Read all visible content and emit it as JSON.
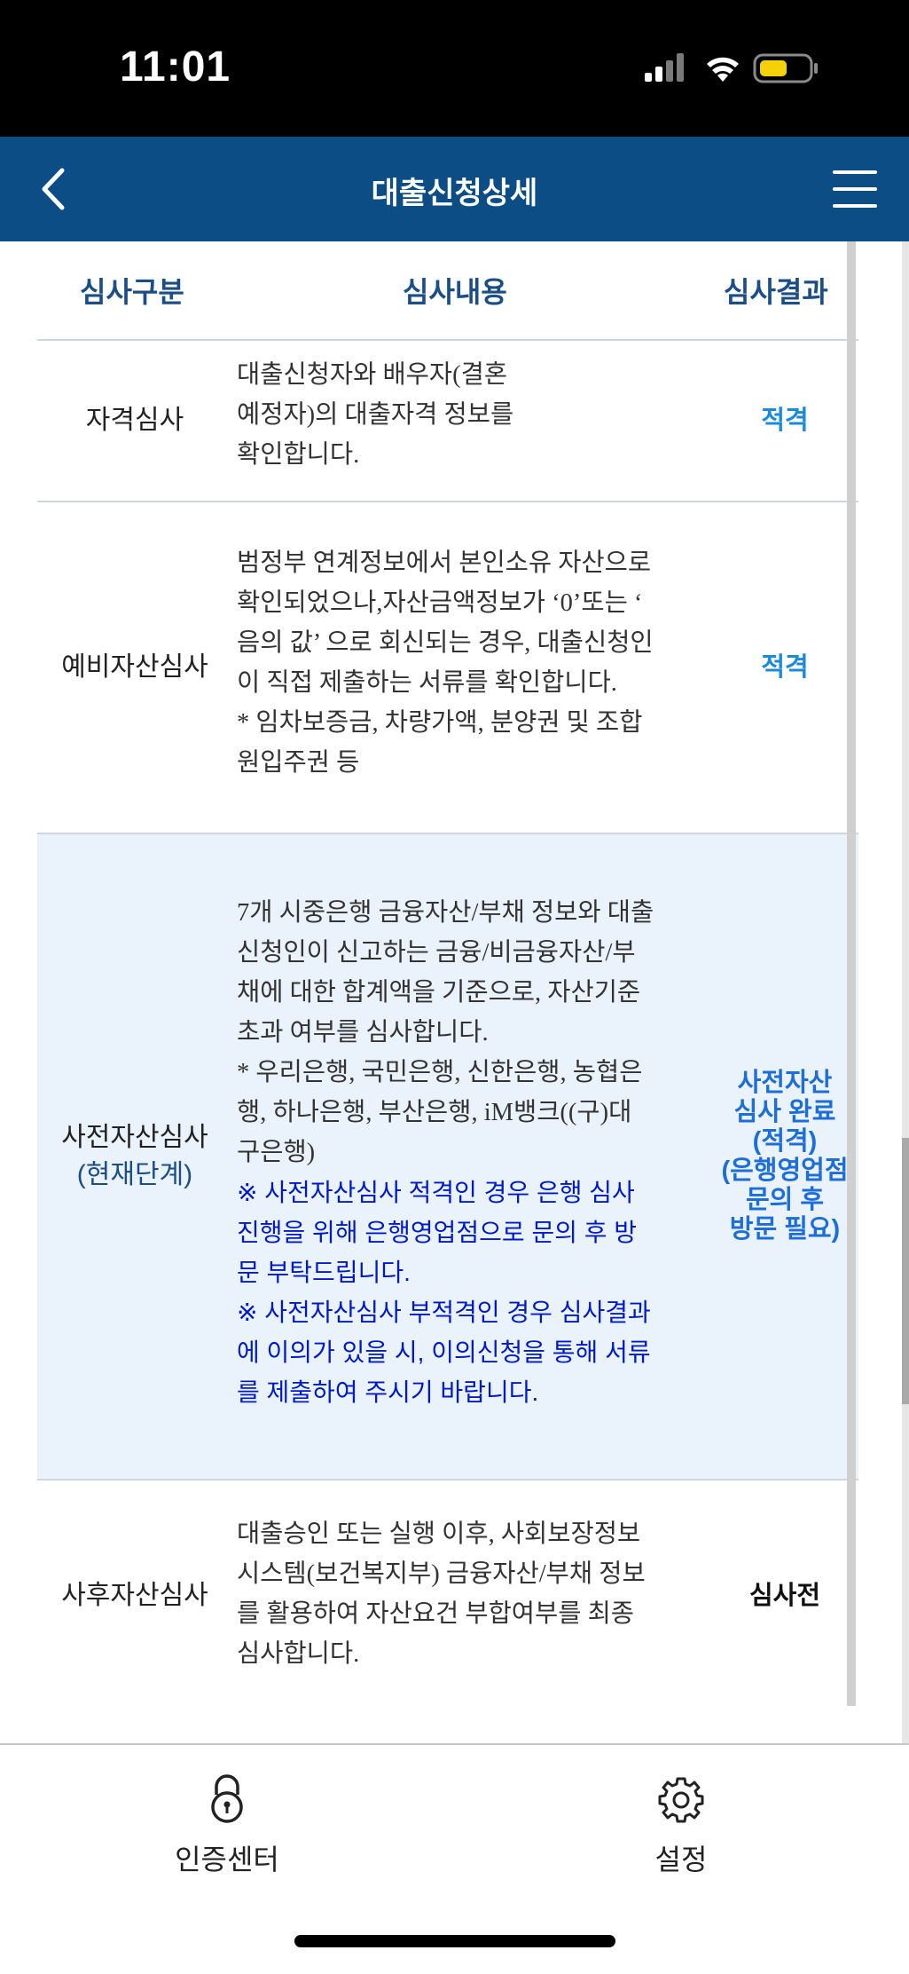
{
  "status_bar": {
    "time": "11:01"
  },
  "header": {
    "title": "대출신청상세"
  },
  "table": {
    "headers": [
      "심사구분",
      "심사내용",
      "심사결과"
    ],
    "rows": [
      {
        "type": "자격심사",
        "content": [
          "대출신청자와 배우자(결혼",
          "예정자)의 대출자격 정보를",
          "확인합니다."
        ],
        "result": "적격"
      },
      {
        "type": "예비자산심사",
        "content": [
          "범정부 연계정보에서 본인소유 자산으로",
          "확인되었으나,자산금액정보가 ‘0’또는 ‘",
          "음의 값’ 으로 회신되는 경우, 대출신청인",
          "이 직접 제출하는 서류를 확인합니다.",
          "* 임차보증금, 차량가액, 분양권 및 조합",
          "원입주권 등"
        ],
        "result": "적격"
      },
      {
        "type": "사전자산심사",
        "type_sub": "(현재단계)",
        "content": [
          "7개 시중은행 금융자산/부채 정보와 대출",
          "신청인이 신고하는 금융/비금융자산/부",
          "채에 대한 합계액을 기준으로, 자산기준",
          "초과 여부를 심사합니다.",
          "* 우리은행, 국민은행, 신한은행, 농협은",
          "행, 하나은행, 부산은행, iM뱅크((구)대",
          "구은행)"
        ],
        "notes": [
          "※ 사전자산심사 적격인 경우 은행 심사",
          "진행을 위해 은행영업점으로 문의 후 방",
          "문 부탁드립니다.",
          "※ 사전자산심사 부적격인 경우 심사결과",
          "에 이의가 있을 시, 이의신청을 통해 서류",
          "를 제출하여 주시기 바랍니다."
        ],
        "result": [
          "사전자산",
          "심사 완료",
          "(적격)",
          "(은행영업점",
          "문의 후",
          "방문 필요)"
        ]
      },
      {
        "type": "사후자산심사",
        "content": [
          "대출승인 또는 실행 이후, 사회보장정보",
          "시스템(보건복지부) 금융자산/부채 정보",
          "를 활용하여 자산요건 부합여부를 최종",
          "심사합니다."
        ],
        "result": "심사전"
      }
    ]
  },
  "tabbar": {
    "auth_label": "인증센터",
    "settings_label": "설정"
  },
  "colors": {
    "header_bg": "#0c4d86",
    "header_text": "#1b4e86",
    "result_blue": "#1d8ad8",
    "note_blue": "#0019c9",
    "current_row_bg": "#eaf3fc"
  }
}
